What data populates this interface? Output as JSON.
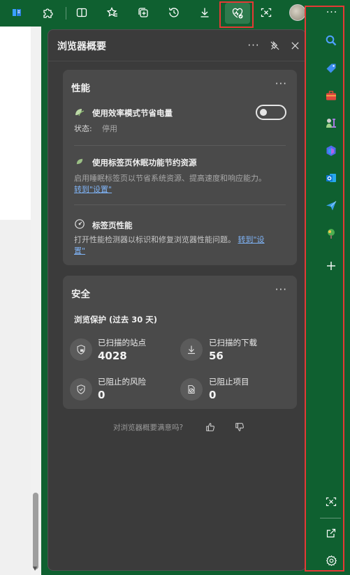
{
  "toolbar": {
    "buttons": [
      {
        "name": "app-icon"
      },
      {
        "name": "extensions-icon"
      },
      {
        "name": "split-screen-icon"
      },
      {
        "name": "favorites-icon"
      },
      {
        "name": "collections-icon"
      },
      {
        "name": "history-icon"
      },
      {
        "name": "downloads-icon"
      },
      {
        "name": "browser-essentials-icon"
      },
      {
        "name": "screenshot-icon"
      },
      {
        "name": "profile-avatar"
      },
      {
        "name": "more-icon"
      }
    ],
    "more_label": "···"
  },
  "panel": {
    "title": "浏览器概要",
    "more_label": "···",
    "pin_icon": "pin-off-icon",
    "close_icon": "close-icon"
  },
  "performance": {
    "title": "性能",
    "more_label": "···",
    "efficiency": {
      "title": "使用效率模式节省电量",
      "status_label": "状态:",
      "status_value": "停用",
      "toggle_on": false
    },
    "sleeping_tabs": {
      "title": "使用标签页休眠功能节约资源",
      "desc": "启用睡眠标签页以节省系统资源、提高速度和响应能力。",
      "link": "转到\"设置\""
    },
    "tab_performance": {
      "title": "标签页性能",
      "desc": "打开性能检测器以标识和修复浏览器性能问题。",
      "link_part1": "转到\"设",
      "link_part2": "置\""
    }
  },
  "security": {
    "title": "安全",
    "more_label": "···",
    "subtitle": "浏览保护 (过去 30 天)",
    "stats": [
      {
        "label": "已扫描的站点",
        "value": "4028",
        "icon": "shield-scan-icon"
      },
      {
        "label": "已扫描的下载",
        "value": "56",
        "icon": "download-icon"
      },
      {
        "label": "已阻止的风险",
        "value": "0",
        "icon": "shield-check-icon"
      },
      {
        "label": "已阻止项目",
        "value": "0",
        "icon": "blocked-item-icon"
      }
    ]
  },
  "feedback": {
    "question": "对浏览器概要满意吗?",
    "like_icon": "thumbs-up-icon",
    "dislike_icon": "thumbs-down-icon"
  },
  "sidebar": {
    "items": [
      {
        "name": "search-icon",
        "color": "#3b82f6"
      },
      {
        "name": "shopping-tag-icon",
        "color": "#2f7de1"
      },
      {
        "name": "tools-icon",
        "color": "#e0483e"
      },
      {
        "name": "games-icon",
        "color": "#8e63c9"
      },
      {
        "name": "copilot-icon",
        "color": "#4f6bed"
      },
      {
        "name": "outlook-icon",
        "color": "#0f78d4"
      },
      {
        "name": "send-icon",
        "color": "#3aa0e8"
      },
      {
        "name": "tree-icon",
        "color": "#4caf50"
      },
      {
        "name": "add-icon",
        "color": "#ffffff"
      },
      {
        "name": "screenshot-icon",
        "color": "#ffffff"
      },
      {
        "name": "open-external-icon",
        "color": "#ffffff"
      },
      {
        "name": "settings-icon",
        "color": "#ffffff"
      }
    ]
  },
  "colors": {
    "toolbar_bg": "#0f6030",
    "panel_bg": "#3b3b3b",
    "card_bg": "#4a4a4a",
    "link": "#7fb3f5",
    "highlight": "#e53935"
  }
}
